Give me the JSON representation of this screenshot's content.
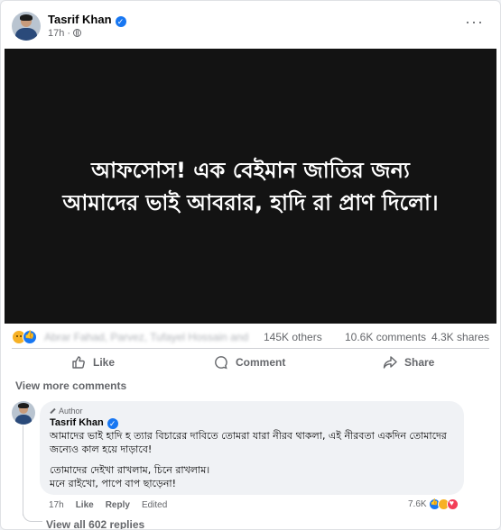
{
  "post": {
    "author": "Tasrif Khan",
    "time": "17h",
    "image_text_line1": "আফসোস! এক বেইমান জাতির জন্য",
    "image_text_line2": "আমাদের ভাই আবরার, হাদি রা প্রাণ দিলো।"
  },
  "reactions": {
    "blurred_names": "Abrar Fahad, Parvez, Tufayel Hossain and",
    "others": "145K others",
    "comments": "10.6K comments",
    "shares": "4.3K shares",
    "icons": [
      "sad-reaction-icon",
      "like-reaction-icon"
    ]
  },
  "actions": {
    "like": "Like",
    "comment": "Comment",
    "share": "Share"
  },
  "comments_section": {
    "view_more": "View more comments",
    "comment": {
      "badge": "Author",
      "author": "Tasrif Khan",
      "text1": "আমাদের ভাই হাদি হ ত্যার বিচারের দাবিতে তোমরা যারা নীরব থাকলা, এই নীরবতা একদিন তোমাদের জন্যেও কাল হয়ে দাড়াবে!",
      "text2": "তোমাদের দেইখা রাখলাম, চিনে রাখলাম।\nমনে রাইখো, পাপে বাপ ছাড়েনা!",
      "time": "17h",
      "like": "Like",
      "reply": "Reply",
      "edited": "Edited",
      "reaction_count": "7.6K"
    },
    "view_replies": "View all 602 replies"
  },
  "colors": {
    "accent": "#1877f2",
    "media_bg": "#131313",
    "secondary_text": "#65676b"
  }
}
